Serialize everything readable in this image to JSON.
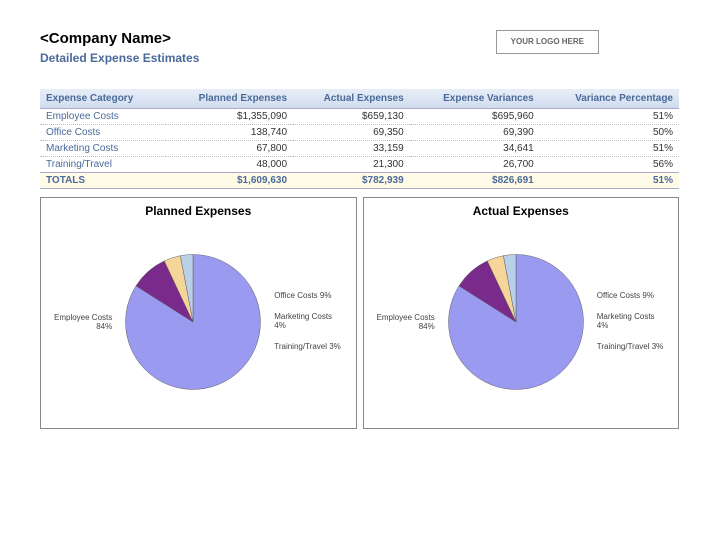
{
  "header": {
    "company_name": "<Company Name>",
    "subtitle": "Detailed Expense Estimates",
    "logo_text": "YOUR LOGO HERE"
  },
  "table": {
    "headers": [
      "Expense Category",
      "Planned Expenses",
      "Actual Expenses",
      "Expense Variances",
      "Variance Percentage"
    ],
    "rows": [
      {
        "category": "Employee Costs",
        "planned": "$1,355,090",
        "actual": "$659,130",
        "variance": "$695,960",
        "pct": "51%"
      },
      {
        "category": "Office Costs",
        "planned": "138,740",
        "actual": "69,350",
        "variance": "69,390",
        "pct": "50%"
      },
      {
        "category": "Marketing Costs",
        "planned": "67,800",
        "actual": "33,159",
        "variance": "34,641",
        "pct": "51%"
      },
      {
        "category": "Training/Travel",
        "planned": "48,000",
        "actual": "21,300",
        "variance": "26,700",
        "pct": "56%"
      }
    ],
    "totals": {
      "category": "TOTALS",
      "planned": "$1,609,630",
      "actual": "$782,939",
      "variance": "$826,691",
      "pct": "51%"
    }
  },
  "chart_data": [
    {
      "type": "pie",
      "title": "Planned Expenses",
      "series": [
        {
          "name": "Employee Costs",
          "pct": 84,
          "color": "#9a9af0"
        },
        {
          "name": "Office Costs",
          "pct": 9,
          "color": "#7a2a8a"
        },
        {
          "name": "Marketing Costs",
          "pct": 4,
          "color": "#f5d59a"
        },
        {
          "name": "Training/Travel",
          "pct": 3,
          "color": "#b8d0e8"
        }
      ],
      "left_label": "Employee Costs 84%",
      "right_labels": [
        "Office Costs 9%",
        "Marketing Costs 4%",
        "Training/Travel 3%"
      ]
    },
    {
      "type": "pie",
      "title": "Actual Expenses",
      "series": [
        {
          "name": "Employee Costs",
          "pct": 84,
          "color": "#9a9af0"
        },
        {
          "name": "Office Costs",
          "pct": 9,
          "color": "#7a2a8a"
        },
        {
          "name": "Marketing Costs",
          "pct": 4,
          "color": "#f5d59a"
        },
        {
          "name": "Training/Travel",
          "pct": 3,
          "color": "#b8d0e8"
        }
      ],
      "left_label": "Employee Costs 84%",
      "right_labels": [
        "Office Costs 9%",
        "Marketing Costs 4%",
        "Training/Travel 3%"
      ]
    }
  ]
}
